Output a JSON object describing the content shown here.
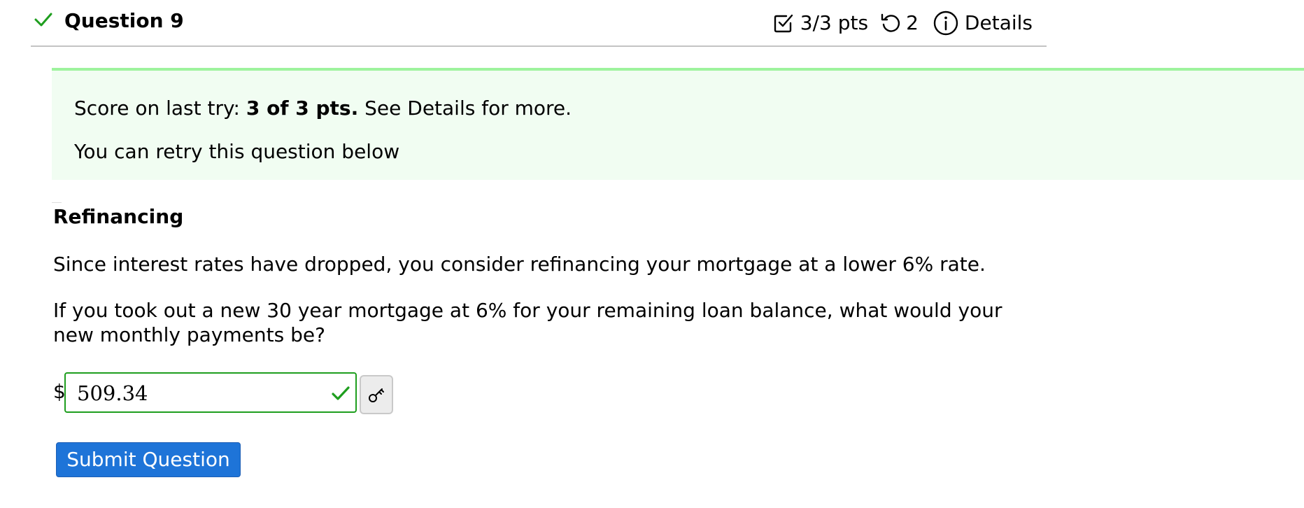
{
  "colors": {
    "correct": "#1e9e1e",
    "banner_background": "#f1fdf2",
    "banner_border": "#9ef39e",
    "submit_background": "#1e74d8",
    "submit_text": "#ffffff",
    "divider": "#c4c4c4"
  },
  "icons": {
    "status": "checkmark-icon",
    "score": "checkbox-icon",
    "tries": "retry-icon",
    "details": "info-icon",
    "answer_status": "checkmark-icon",
    "formula_key": "key-icon"
  },
  "header": {
    "title": "Question 9",
    "score": "3/3 pts",
    "tries": "2",
    "details_label": "Details"
  },
  "banner": {
    "score_prefix": "Score on last try: ",
    "score_value": "3 of 3 pts.",
    "score_suffix": " See Details for more.",
    "retry_text": "You can retry this question below"
  },
  "question": {
    "heading": "Refinancing",
    "paragraph_1": "Since interest rates have dropped, you consider refinancing your mortgage at a lower 6% rate.",
    "paragraph_2": "If you took out a new 30 year mortgage at 6% for your remaining loan balance, what would your new monthly payments be?"
  },
  "answer": {
    "prefix": "$",
    "value": "509.34"
  },
  "submit": {
    "label": "Submit Question"
  }
}
